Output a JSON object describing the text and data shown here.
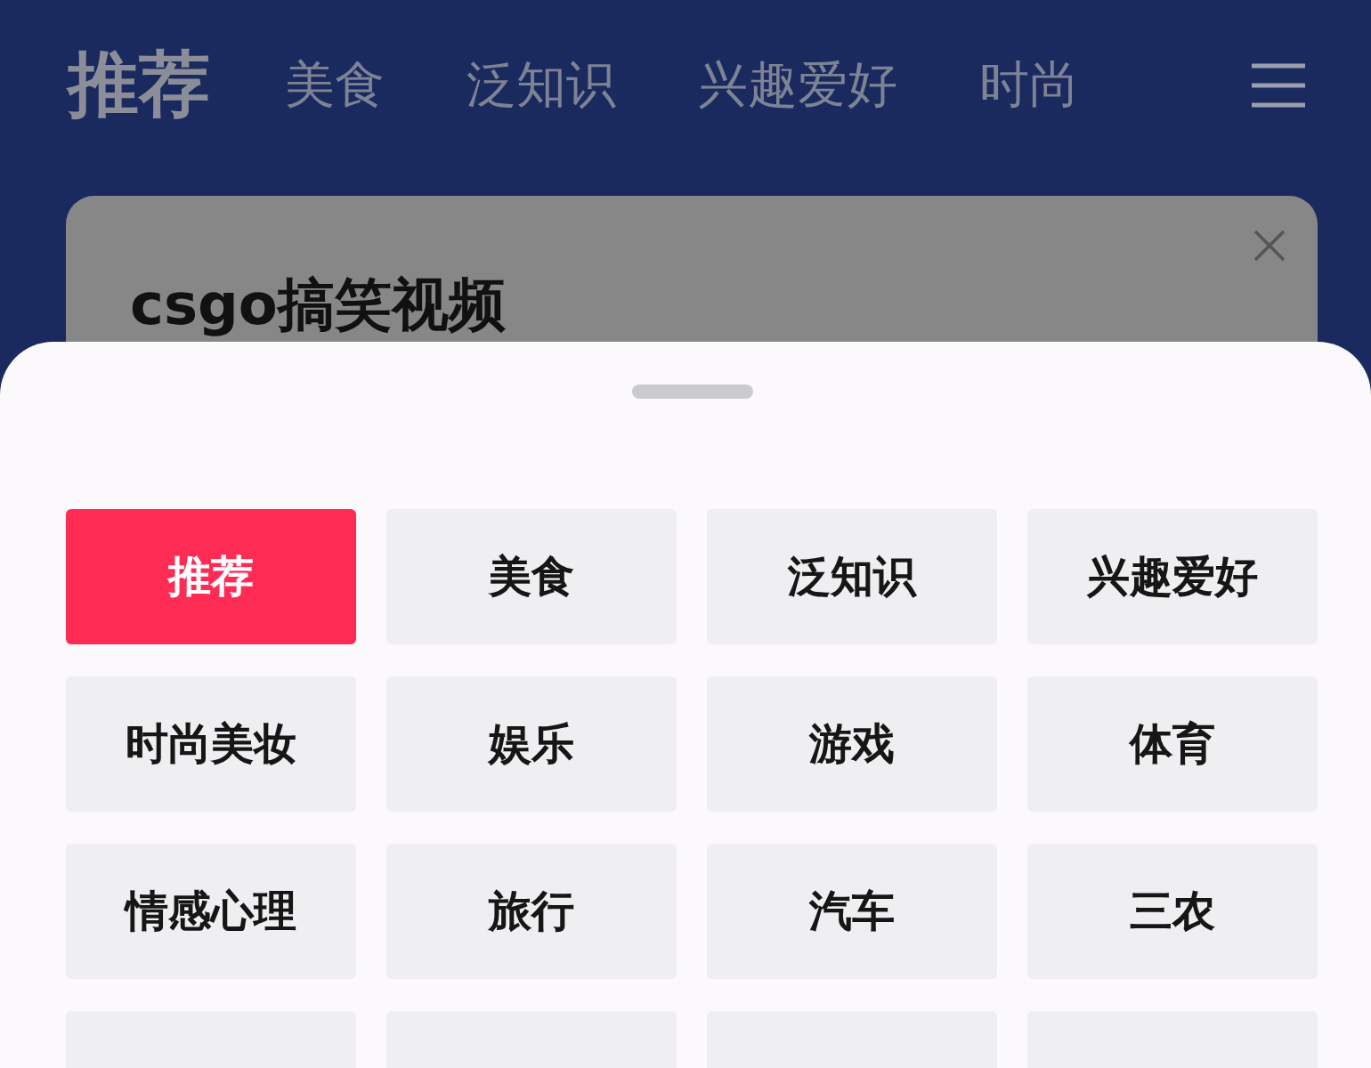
{
  "tabs": [
    {
      "label": "推荐",
      "selected": true
    },
    {
      "label": "美食",
      "selected": false
    },
    {
      "label": "泛知识",
      "selected": false
    },
    {
      "label": "兴趣爱好",
      "selected": false
    },
    {
      "label": "时尚",
      "selected": false
    }
  ],
  "card": {
    "title": "csgo搞笑视频"
  },
  "channel_sheet": {
    "items": [
      {
        "label": "推荐",
        "selected": true
      },
      {
        "label": "美食",
        "selected": false
      },
      {
        "label": "泛知识",
        "selected": false
      },
      {
        "label": "兴趣爱好",
        "selected": false
      },
      {
        "label": "时尚美妆",
        "selected": false
      },
      {
        "label": "娱乐",
        "selected": false
      },
      {
        "label": "游戏",
        "selected": false
      },
      {
        "label": "体育",
        "selected": false
      },
      {
        "label": "情感心理",
        "selected": false
      },
      {
        "label": "旅行",
        "selected": false
      },
      {
        "label": "汽车",
        "selected": false
      },
      {
        "label": "三农",
        "selected": false
      },
      {
        "selected": false
      },
      {
        "selected": false
      },
      {
        "selected": false
      },
      {
        "selected": false
      }
    ]
  }
}
